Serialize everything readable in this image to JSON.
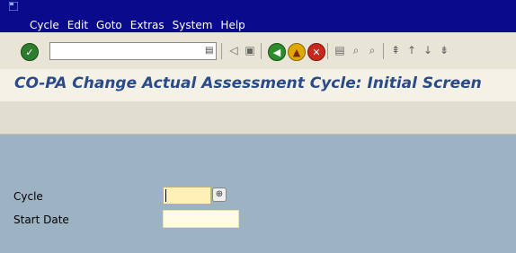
{
  "menu": {
    "items": [
      "Cycle",
      "Edit",
      "Goto",
      "Extras",
      "System",
      "Help"
    ]
  },
  "command": {
    "value": ""
  },
  "title": "CO-PA Change Actual Assessment Cycle: Initial Screen",
  "form": {
    "cycle_label": "Cycle",
    "cycle_value": "",
    "start_date_label": "Start Date",
    "start_date_value": ""
  },
  "colors": {
    "menubar": "#0a0a8c",
    "title": "#2a4a8a",
    "background": "#9cb3c4",
    "required_field": "#fff1b8"
  }
}
